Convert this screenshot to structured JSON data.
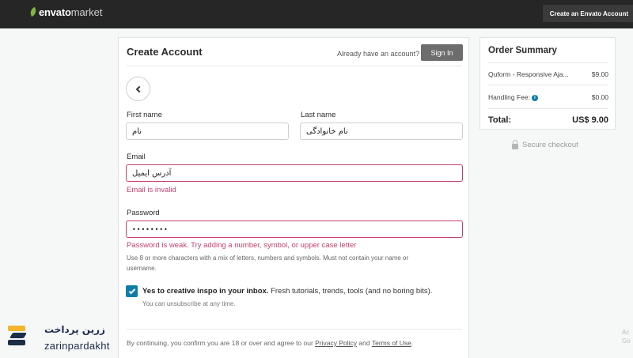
{
  "header": {
    "logo_brand": "envato",
    "logo_market": "market",
    "create_account_button": "Create an Envato Account"
  },
  "form": {
    "title": "Create Account",
    "already_text": "Already have an account?",
    "signin_label": "Sign In",
    "first_name": {
      "label": "First name",
      "value": "نام"
    },
    "last_name": {
      "label": "Last name",
      "value": "نام خانوادگی"
    },
    "email": {
      "label": "Email",
      "value": "آدرس ایمیل",
      "error": "Email is invalid"
    },
    "password": {
      "label": "Password",
      "value": "••••••••",
      "error": "Password is weak. Try adding a number, symbol, or upper case letter",
      "hint_line1": "Use 8 or more characters with a mix of letters, numbers and symbols. Must not contain your name or",
      "hint_line2": "username."
    },
    "consent": {
      "checked": true,
      "bold": "Yes to creative inspo in your inbox.",
      "rest": " Fresh tutorials, trends, tools (and no boring bits).",
      "unsubscribe": "You can unsubscribe at any time."
    },
    "terms": {
      "prefix": "By continuing, you confirm you are 18 or over and agree to our ",
      "privacy": "Privacy Policy",
      "and": " and ",
      "terms_link": "Terms of Use",
      "suffix": "."
    }
  },
  "summary": {
    "title": "Order Summary",
    "item_name": "Quform - Responsive Aja...",
    "item_price": "$9.00",
    "fee_label": "Handling Fee:",
    "fee_value": "$0.00",
    "total_label": "Total:",
    "total_value": "US$ 9.00"
  },
  "secure_checkout": "Secure checkout",
  "watermark": {
    "fa": "زرین پرداخت",
    "en": "zarinpardakht"
  },
  "edge": {
    "line1": "Ac",
    "line2": "Go"
  },
  "colors": {
    "error": "#c7416d",
    "accent": "#0e7ea8",
    "header_bg": "#262626",
    "brand_green": "#82b541"
  }
}
